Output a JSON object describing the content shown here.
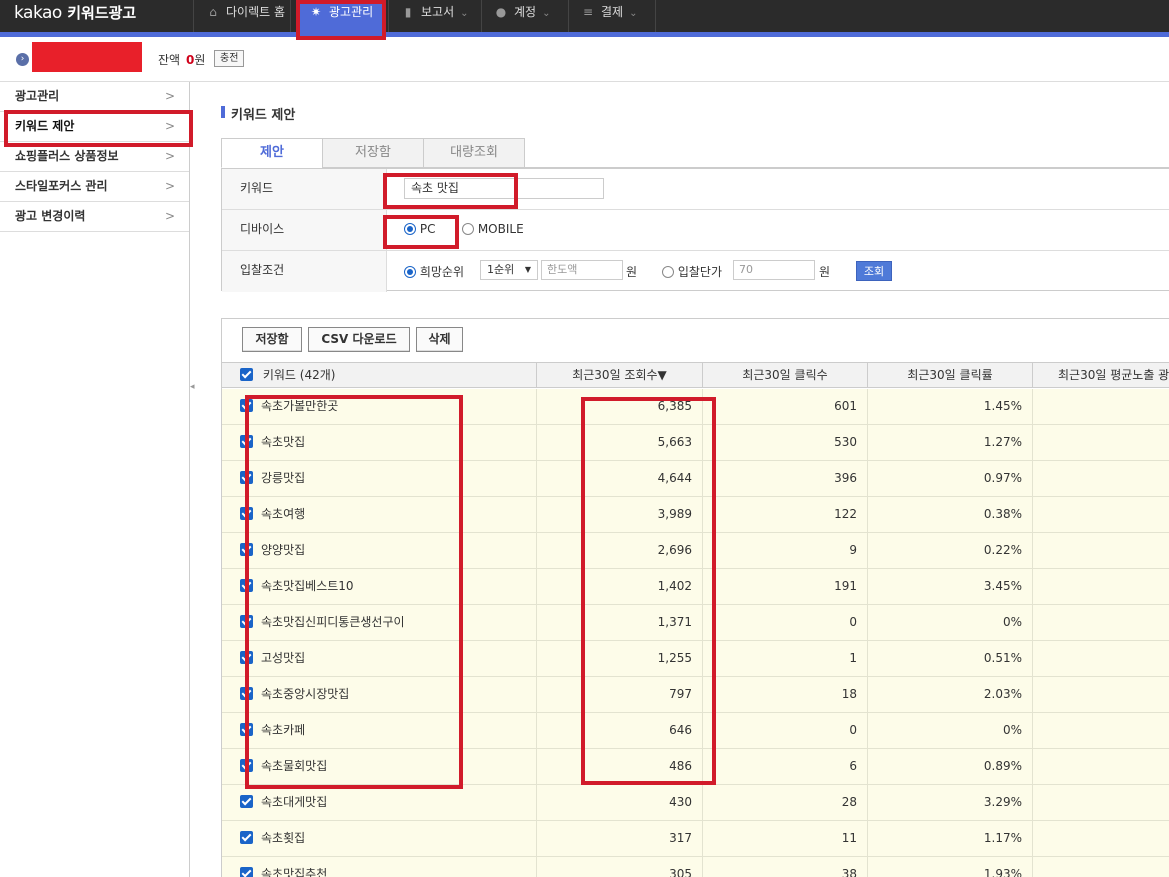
{
  "brand": {
    "kakao": "kakao",
    "product": "키워드광고"
  },
  "nav": {
    "items": [
      {
        "label": "다이렉트 홈",
        "icon": "home-icon",
        "caret": ""
      },
      {
        "label": "광고관리",
        "icon": "gear-icon",
        "caret": ""
      },
      {
        "label": "보고서",
        "icon": "bar-chart-icon",
        "caret": "⌄"
      },
      {
        "label": "계정",
        "icon": "user-icon",
        "caret": "⌄"
      },
      {
        "label": "결제",
        "icon": "database-icon",
        "caret": "⌄"
      }
    ]
  },
  "account": {
    "balance_label": "잔액",
    "balance_value": "0",
    "balance_unit": "원",
    "charge_label": "충전"
  },
  "sidebar": {
    "items": [
      {
        "label": "광고관리"
      },
      {
        "label": "키워드 제안"
      },
      {
        "label": "쇼핑플러스 상품정보"
      },
      {
        "label": "스타일포커스 관리"
      },
      {
        "label": "광고 변경이력"
      }
    ],
    "chevron": ">"
  },
  "page": {
    "title": "키워드 제안"
  },
  "tabs": [
    {
      "label": "제안"
    },
    {
      "label": "저장함"
    },
    {
      "label": "대량조회"
    }
  ],
  "form": {
    "keyword_label": "키워드",
    "keyword_value": "속초 맛집",
    "device_label": "디바이스",
    "device_pc": "PC",
    "device_mobile": "MOBILE",
    "bid_label": "입찰조건",
    "bid_rank_option": "희망순위",
    "rank_select": "1순위",
    "limit_placeholder": "한도액",
    "unit_won": "원",
    "bid_price_option": "입찰단가",
    "bid_price_placeholder": "70",
    "query_button": "조회"
  },
  "toolbar": {
    "save": "저장함",
    "csv": "CSV 다운로드",
    "delete": "삭제"
  },
  "table": {
    "headers": {
      "keyword": "키워드 (42개)",
      "views": "최근30일 조회수▼",
      "clicks": "최근30일 클릭수",
      "ctr": "최근30일 클릭률",
      "avg": "최근30일 평균노출 광"
    },
    "rows": [
      {
        "keyword": "속초가볼만한곳",
        "views": "6,385",
        "clicks": "601",
        "ctr": "1.45%"
      },
      {
        "keyword": "속초맛집",
        "views": "5,663",
        "clicks": "530",
        "ctr": "1.27%"
      },
      {
        "keyword": "강릉맛집",
        "views": "4,644",
        "clicks": "396",
        "ctr": "0.97%"
      },
      {
        "keyword": "속초여행",
        "views": "3,989",
        "clicks": "122",
        "ctr": "0.38%"
      },
      {
        "keyword": "양양맛집",
        "views": "2,696",
        "clicks": "9",
        "ctr": "0.22%"
      },
      {
        "keyword": "속초맛집베스트10",
        "views": "1,402",
        "clicks": "191",
        "ctr": "3.45%"
      },
      {
        "keyword": "속초맛집신피디통큰생선구이",
        "views": "1,371",
        "clicks": "0",
        "ctr": "0%"
      },
      {
        "keyword": "고성맛집",
        "views": "1,255",
        "clicks": "1",
        "ctr": "0.51%"
      },
      {
        "keyword": "속초중앙시장맛집",
        "views": "797",
        "clicks": "18",
        "ctr": "2.03%"
      },
      {
        "keyword": "속초카페",
        "views": "646",
        "clicks": "0",
        "ctr": "0%"
      },
      {
        "keyword": "속초물회맛집",
        "views": "486",
        "clicks": "6",
        "ctr": "0.89%"
      },
      {
        "keyword": "속초대게맛집",
        "views": "430",
        "clicks": "28",
        "ctr": "3.29%"
      },
      {
        "keyword": "속초횟집",
        "views": "317",
        "clicks": "11",
        "ctr": "1.17%"
      },
      {
        "keyword": "속초맛집추천",
        "views": "305",
        "clicks": "38",
        "ctr": "1.93%"
      }
    ]
  },
  "colors": {
    "accent": "#4f6bd8",
    "highlight_box": "#d11b2a",
    "row_bg": "#fdfce9",
    "nav_bg": "#2b2b2b"
  }
}
